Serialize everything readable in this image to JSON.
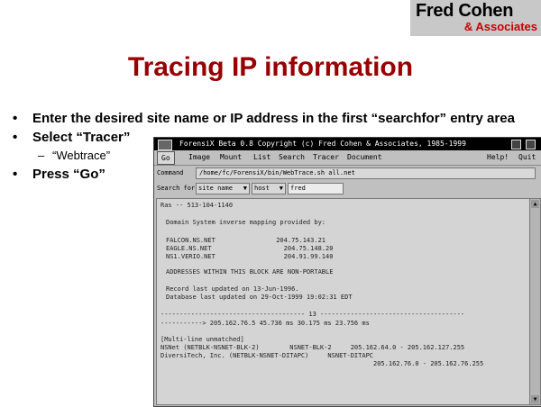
{
  "logo": {
    "name": "Fred Cohen",
    "sub": "& Associates"
  },
  "slide": {
    "title": "Tracing IP information",
    "bullets": [
      "Enter the desired site name or IP address in the first “searchfor” entry area",
      "Select “Tracer”",
      "“Webtrace”",
      "Press “Go”"
    ],
    "bullet_marker": "•",
    "sub_marker": "–"
  },
  "app": {
    "title": "ForensiX Beta 0.8 Copyright (c) Fred Cohen & Associates, 1985-1999",
    "menu": {
      "go": "Go",
      "image": "Image",
      "mount": "Mount",
      "list": "List",
      "search": "Search",
      "tracer": "Tracer",
      "document": "Document",
      "help": "Help!",
      "quit": "Quit"
    },
    "command_label": "Command",
    "command_value": "/home/fc/ForensiX/bin/WebTrace.sh all.net",
    "search_label": "Search for",
    "search_select_1": "site name",
    "search_select_2": "host",
    "search_value": "fred",
    "output_lines": [
      "Ras -- 513-104-1140",
      "Domain System inverse mapping provided by:",
      "FALCON.NS.NET                204.75.143.21",
      "EAGLE.NS.NET                   204.75.148.20",
      "NS1.VERIO.NET                  204.91.99.140",
      "ADDRESSES WITHIN THIS BLOCK ARE NON-PORTABLE",
      "Record last updated on 13-Jun-1996.",
      "Database last updated on 29-Oct-1999 19:02:31 EDT",
      "-------------------------------------- 13 --------------------------------------",
      "-----------> 205.162.76.5 45.736 ms 30.175 ms 23.756 ms",
      "[Multi-line unmatched]",
      "NSNet (NETBLK-NSNET-BLK-2)        NSNET-BLK-2     205.162.64.0 - 205.162.127.255",
      "DiversiTech, Inc. (NETBLK-NSNET-DITAPC)     NSNET-DITAPC",
      "                                                        205.162.76.0 - 205.162.76.255"
    ]
  }
}
